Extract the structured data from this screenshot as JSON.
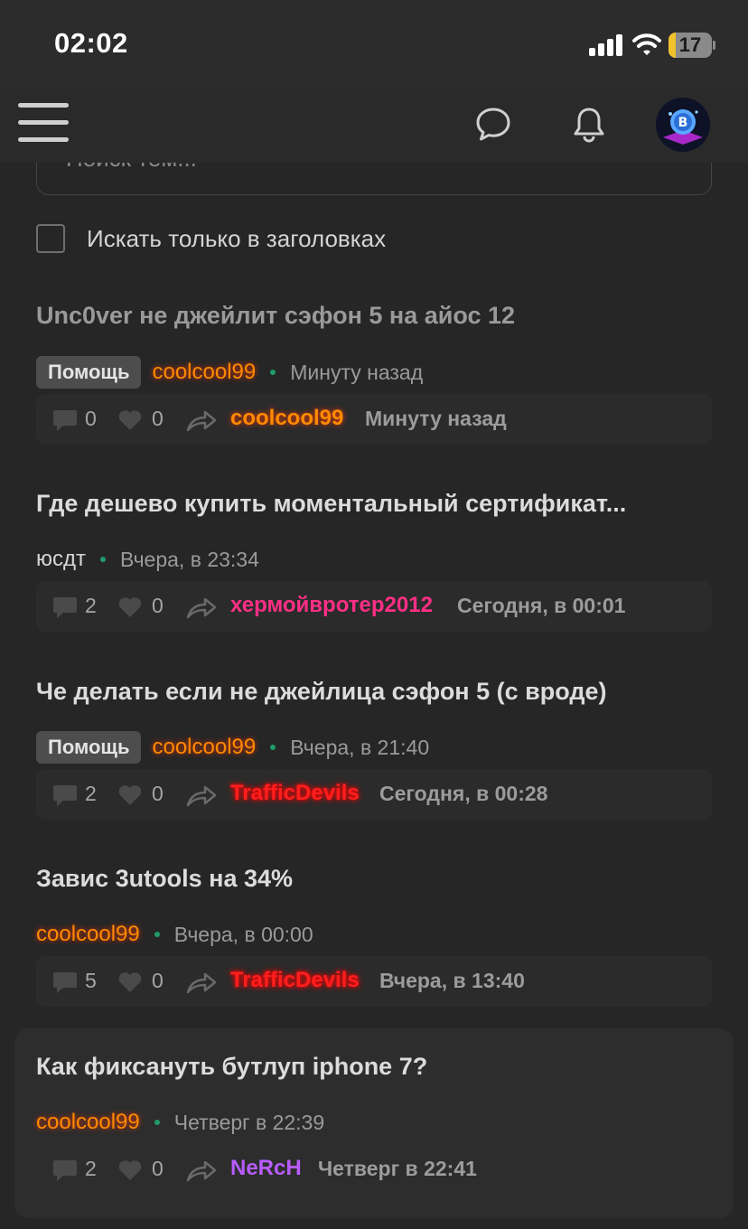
{
  "status_bar": {
    "time": "02:02",
    "battery": "17"
  },
  "navbar": {
    "menu_icon": "hamburger-icon",
    "chat_icon": "chat-bubble-icon",
    "bell_icon": "bell-icon"
  },
  "search": {
    "placeholder": "Поиск тем...",
    "titles_only_label": "Искать только в заголовках"
  },
  "threads": [
    {
      "title": "Unc0ver не джейлит сэфон 5 на айос 12",
      "tag": "Помощь",
      "author": "coolcool99",
      "author_color": "orange",
      "time": "Минуту назад",
      "replies": "0",
      "likes": "0",
      "last_user": "coolcool99",
      "last_user_color": "orange",
      "last_time": "Минуту назад"
    },
    {
      "title": "Где дешево купить моментальный сертификат...",
      "tag": "",
      "author": "юсдт",
      "author_color": "gray",
      "time": "Вчера, в 23:34",
      "replies": "2",
      "likes": "0",
      "last_user": "хермойвротер2012",
      "last_user_color": "pink",
      "last_time": "Сегодня, в 00:01"
    },
    {
      "title": "Че делать если не джейлица сэфон 5 (с вроде)",
      "tag": "Помощь",
      "author": "coolcool99",
      "author_color": "orange",
      "time": "Вчера, в 21:40",
      "replies": "2",
      "likes": "0",
      "last_user": "TrafficDevils",
      "last_user_color": "red",
      "last_time": "Сегодня, в 00:28"
    },
    {
      "title": "Завис 3utools на 34%",
      "tag": "",
      "author": "coolcool99",
      "author_color": "orange",
      "time": "Вчера, в 00:00",
      "replies": "5",
      "likes": "0",
      "last_user": "TrafficDevils",
      "last_user_color": "red",
      "last_time": "Вчера, в 13:40"
    },
    {
      "title": "Как фиксануть бутлуп iphone 7?",
      "tag": "",
      "author": "coolcool99",
      "author_color": "orange",
      "time": "Четверг в 22:39",
      "replies": "2",
      "likes": "0",
      "last_user": "NeRcH",
      "last_user_color": "purple",
      "last_time": "Четверг в 22:41"
    }
  ]
}
